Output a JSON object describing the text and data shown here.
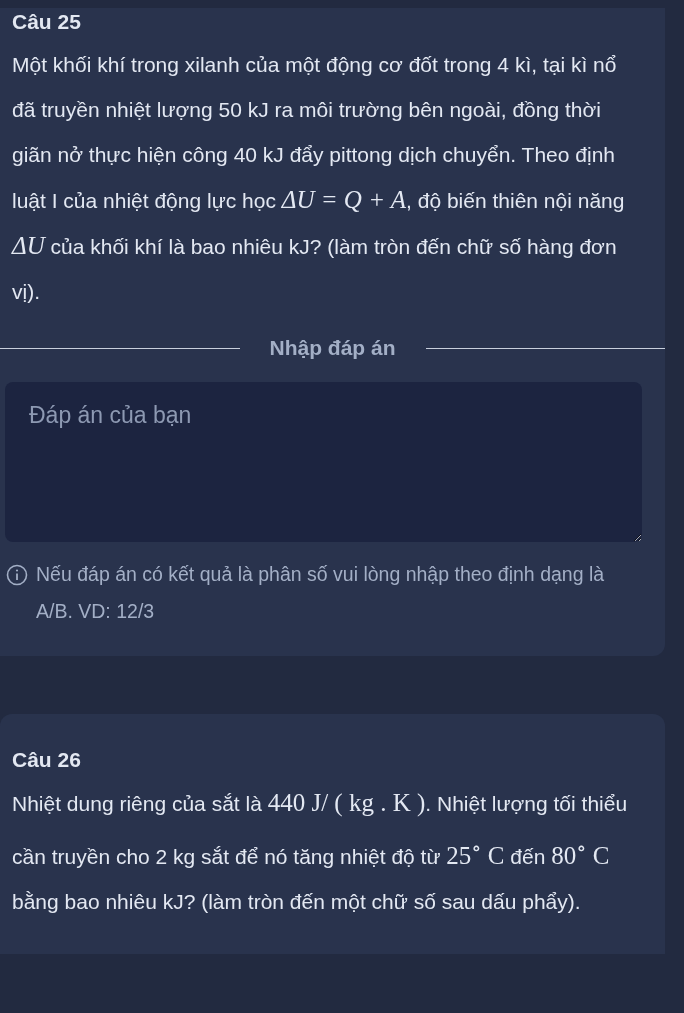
{
  "questions": [
    {
      "title": "Câu 25",
      "body": [
        {
          "kind": "text",
          "text": "Một khối khí trong xilanh của một động cơ đốt trong 4 kì, tại kì nổ đã truyền nhiệt lượng 50 kJ ra môi trường bên ngoài, đồng thời giãn nở thực hiện công 40 kJ đẩy pittong dịch chuyển. Theo định luật I của nhiệt động lực học "
        },
        {
          "kind": "math",
          "italic": true,
          "text": "ΔU = Q + A"
        },
        {
          "kind": "text",
          "text": ", độ biến thiên nội năng "
        },
        {
          "kind": "math",
          "italic": true,
          "text": "ΔU"
        },
        {
          "kind": "text",
          "text": " của khối khí là bao nhiêu kJ? (làm tròn đến chữ số hàng đơn vị)."
        }
      ],
      "answer": {
        "divider_label": "Nhập đáp án",
        "placeholder": "Đáp án của bạn",
        "hint": "Nếu đáp án có kết quả là phân số vui lòng nhập theo định dạng là A/B. VD: 12/3"
      }
    },
    {
      "title": "Câu 26",
      "body": [
        {
          "kind": "text",
          "text": "Nhiệt dung riêng của sắt là "
        },
        {
          "kind": "math",
          "text": "440  J/ ( kg . K )"
        },
        {
          "kind": "text",
          "text": ". Nhiệt lượng tối thiểu cần truyền cho 2 kg sắt để nó tăng nhiệt độ từ "
        },
        {
          "kind": "math",
          "text": "25$^{∘}$ C"
        },
        {
          "kind": "text",
          "text": " đến "
        },
        {
          "kind": "math",
          "text": "80$^{∘}$ C"
        },
        {
          "kind": "text",
          "text": " bằng bao nhiêu kJ? (làm tròn đến một chữ số sau dấu phẩy)."
        }
      ]
    }
  ]
}
